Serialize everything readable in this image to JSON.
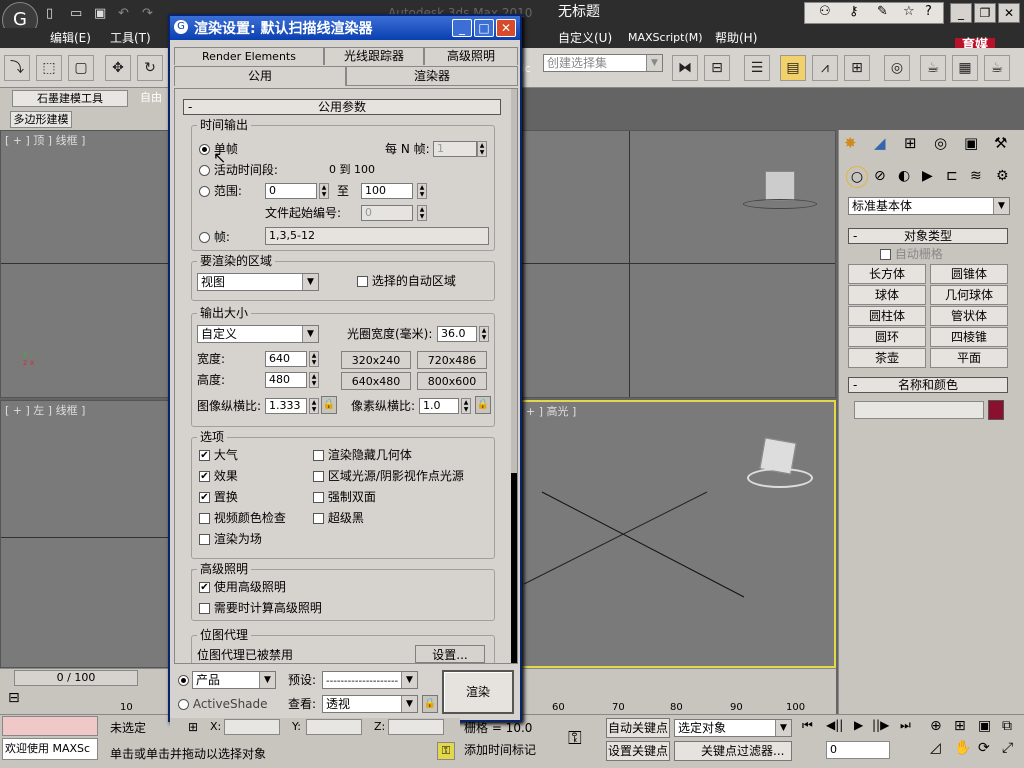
{
  "app": {
    "title_left": "Autodesk 3ds Max 2010",
    "title_doc": "无标题"
  },
  "menu": [
    "编辑(E)",
    "工具(T)",
    "自定义(U)",
    "MAXScript(M)",
    "帮助(H)"
  ],
  "toolbar": {
    "selection_set_placeholder": "创建选择集"
  },
  "ribbon": {
    "tab1": "石墨建模工具",
    "tab2": "自由",
    "subtab": "多边形建模"
  },
  "viewports": {
    "top": "[ + ] 顶 ] 线框 ]",
    "left": "[ + ] 左 ] 线框 ]",
    "persp": "+ ] 高光 ]"
  },
  "logo": {
    "line1": "育媒",
    "line2": "软件"
  },
  "command_panel": {
    "category": "标准基本体",
    "rollout1": "对象类型",
    "autogrid": "自动栅格",
    "objects": [
      "长方体",
      "圆锥体",
      "球体",
      "几何球体",
      "圆柱体",
      "管状体",
      "圆环",
      "四棱锥",
      "茶壶",
      "平面"
    ],
    "rollout2": "名称和颜色",
    "color": "#8b1030"
  },
  "dialog": {
    "title": "渲染设置: 默认扫描线渲染器",
    "tabs_row1": [
      "Render Elements",
      "光线跟踪器",
      "高级照明"
    ],
    "tabs_row2": [
      "公用",
      "渲染器"
    ],
    "rollout": "公用参数",
    "time_output": {
      "label": "时间输出",
      "single": "单帧",
      "every_n": "每 N 帧:",
      "every_n_val": "1",
      "active": "活动时间段:",
      "active_range": "0 到 100",
      "range": "范围:",
      "range_from": "0",
      "to": "至",
      "range_to": "100",
      "file_start": "文件起始编号:",
      "file_start_val": "0",
      "frames": "帧:",
      "frames_val": "1,3,5-12"
    },
    "area": {
      "label": "要渲染的区域",
      "value": "视图",
      "auto_region": "选择的自动区域"
    },
    "output_size": {
      "label": "输出大小",
      "preset": "自定义",
      "aperture_label": "光圈宽度(毫米):",
      "aperture_val": "36.0",
      "width_label": "宽度:",
      "width_val": "640",
      "height_label": "高度:",
      "height_val": "480",
      "presets": [
        "320x240",
        "720x486",
        "640x480",
        "800x600"
      ],
      "image_aspect_label": "图像纵横比:",
      "image_aspect_val": "1.333",
      "pixel_aspect_label": "像素纵横比:",
      "pixel_aspect_val": "1.0"
    },
    "options": {
      "label": "选项",
      "left": [
        "大气",
        "效果",
        "置换",
        "视频颜色检查",
        "渲染为场"
      ],
      "right": [
        "渲染隐藏几何体",
        "区域光源/阴影视作点光源",
        "强制双面",
        "超级黑"
      ]
    },
    "advanced_lighting": {
      "label": "高级照明",
      "use": "使用高级照明",
      "compute": "需要时计算高级照明"
    },
    "bitmap_proxy": {
      "label": "位图代理",
      "status": "位图代理已被禁用",
      "setup": "设置..."
    },
    "bottom": {
      "product": "产品",
      "activeshade": "ActiveShade",
      "preset_label": "预设:",
      "preset_val": "--------------------",
      "view_label": "查看:",
      "view_val": "透视",
      "render": "渲染"
    }
  },
  "timeline": {
    "frame": "0 / 100",
    "ticks": [
      "10",
      "60",
      "70",
      "80",
      "90",
      "100"
    ]
  },
  "status": {
    "welcome": "欢迎使用 MAXSc",
    "unselected": "未选定",
    "prompt": "单击或单击并拖动以选择对象",
    "x": "X:",
    "y": "Y:",
    "z": "Z:",
    "grid": "栅格 = 10.0",
    "add_tag": "添加时间标记",
    "auto_key": "自动关键点",
    "set_key": "设置关键点",
    "selected": "选定对象",
    "key_filters": "关键点过滤器...",
    "frame": "0"
  }
}
